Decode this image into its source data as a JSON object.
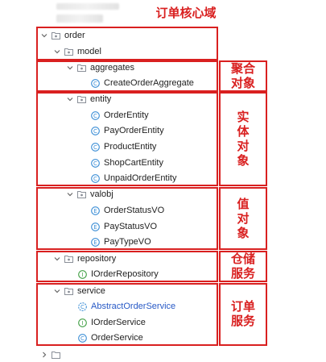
{
  "tree": {
    "order": "order",
    "model": "model",
    "aggregates": "aggregates",
    "create_order_aggregate": "CreateOrderAggregate",
    "entity": "entity",
    "order_entity": "OrderEntity",
    "pay_order_entity": "PayOrderEntity",
    "product_entity": "ProductEntity",
    "shop_cart_entity": "ShopCartEntity",
    "unpaid_order_entity": "UnpaidOrderEntity",
    "valobj": "valobj",
    "order_status_vo": "OrderStatusVO",
    "pay_status_vo": "PayStatusVO",
    "pay_type_vo": "PayTypeVO",
    "repository": "repository",
    "i_order_repository": "IOrderRepository",
    "service": "service",
    "abstract_order_service": "AbstractOrderService",
    "i_order_service": "IOrderService",
    "order_service": "OrderService"
  },
  "annotations": {
    "core_domain": "订单核心域",
    "aggregate": [
      "聚合",
      "对象"
    ],
    "entity": [
      "实",
      "体",
      "对",
      "象"
    ],
    "value_object": [
      "值",
      "对",
      "象"
    ],
    "repository": [
      "仓储",
      "服务"
    ],
    "service": [
      "订单",
      "服务"
    ]
  },
  "colors": {
    "annotation_red": "#d92020",
    "class_icon": "#3d8fd6",
    "enum_icon": "#3d8fd6",
    "interface_icon": "#42a046",
    "folder_icon": "#8a8f98",
    "abstract_label": "#2759c6"
  },
  "icons": {
    "folder": "package-folder-icon",
    "class": "class-icon",
    "enum": "enum-icon",
    "interface": "interface-icon",
    "expand": "chevron-down-icon"
  }
}
